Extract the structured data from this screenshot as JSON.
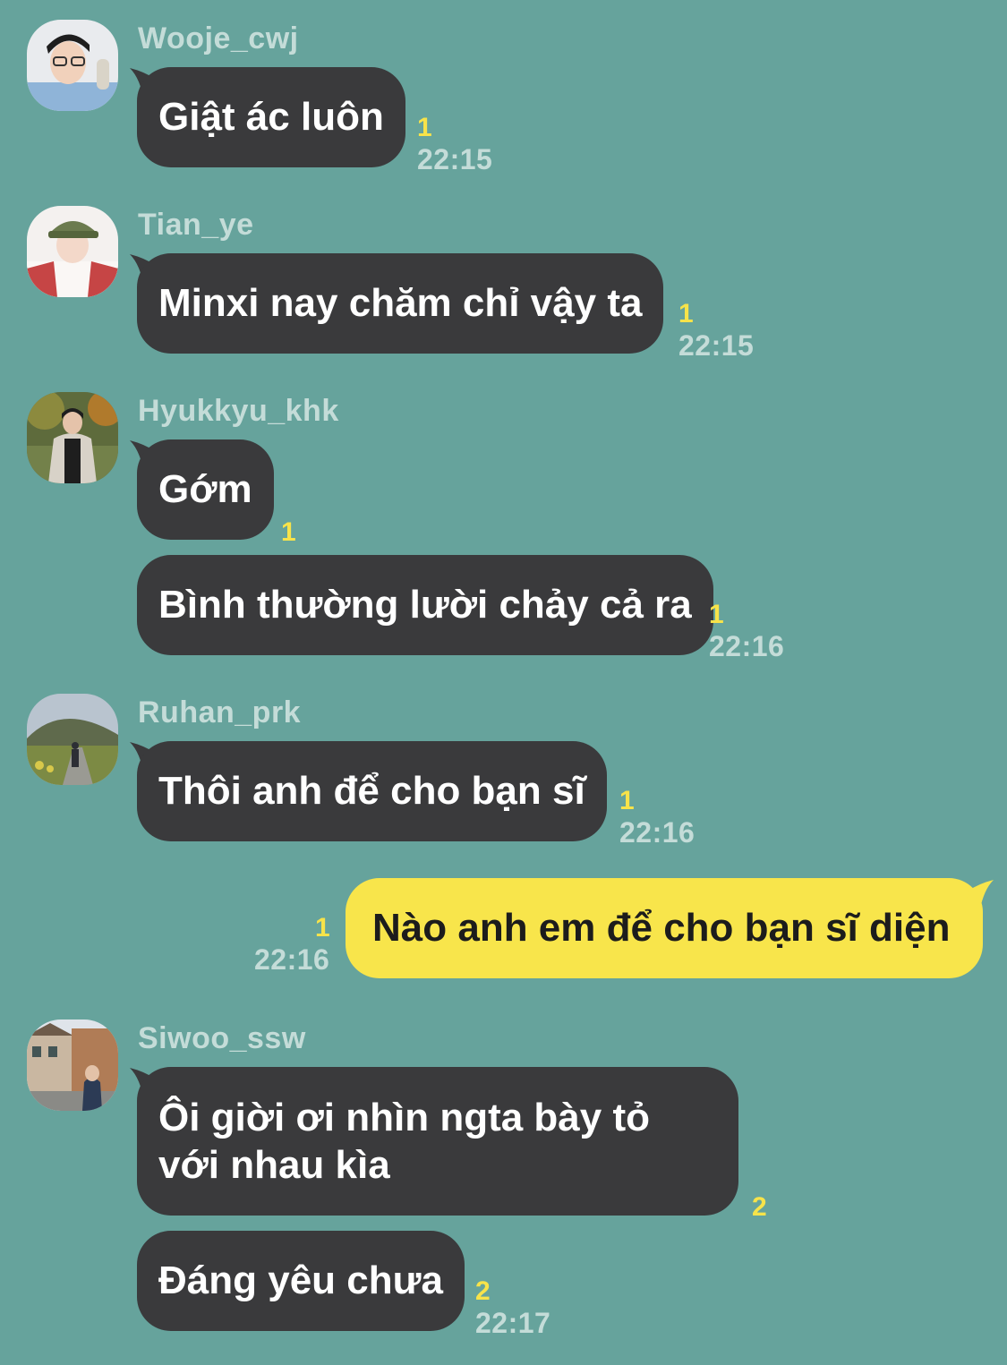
{
  "messages": [
    {
      "sender": "Wooje_cwj",
      "avatar": "profile-photo-icon",
      "text": "Giật ác luôn",
      "unread": "1",
      "time": "22:15"
    },
    {
      "sender": "Tian_ye",
      "avatar": "profile-photo-icon",
      "text": "Minxi nay chăm chỉ vậy ta",
      "unread": "1",
      "time": "22:15"
    },
    {
      "sender": "Hyukkyu_khk",
      "avatar": "profile-photo-icon",
      "text": "Gớm",
      "unread": "1"
    },
    {
      "text": "Bình thường lười chảy cả ra",
      "unread": "1",
      "time": "22:16"
    },
    {
      "sender": "Ruhan_prk",
      "avatar": "profile-photo-icon",
      "text": "Thôi anh để cho bạn sĩ",
      "unread": "1",
      "time": "22:16"
    },
    {
      "own": true,
      "text": "Nào anh em để cho bạn sĩ diện",
      "unread": "1",
      "time": "22:16"
    },
    {
      "sender": "Siwoo_ssw",
      "avatar": "profile-photo-icon",
      "text": "Ôi giời ơi nhìn ngta bày tỏ với nhau kìa",
      "unread": "2"
    },
    {
      "text": "Đáng yêu chưa",
      "unread": "2",
      "time": "22:17"
    }
  ],
  "colors": {
    "background": "#66a39c",
    "incoming_bubble": "#3a3a3c",
    "outgoing_bubble": "#f8e54b",
    "unread": "#f7e34a",
    "meta_text": "#c4dcd8"
  }
}
